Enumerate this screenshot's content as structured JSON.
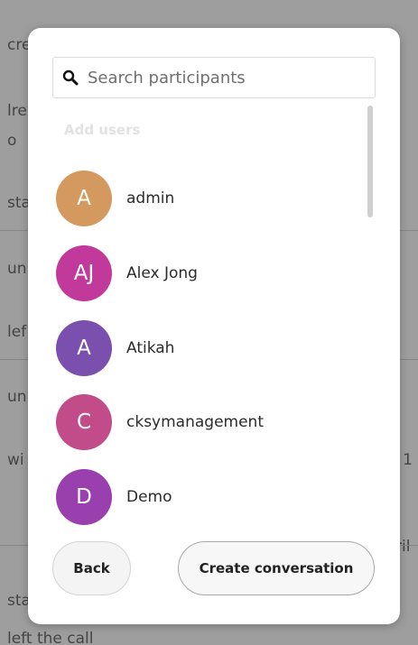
{
  "background": {
    "fragments": [
      "cre",
      "lre",
      "o",
      "sta",
      "un",
      "lef",
      "un",
      "wi",
      "n 1",
      "ril",
      "sta",
      "left the call"
    ]
  },
  "modal": {
    "search": {
      "placeholder": "Search participants",
      "value": ""
    },
    "section_label": "Add users",
    "users": [
      {
        "initials": "A",
        "name": "admin",
        "color": "#d4995f"
      },
      {
        "initials": "AJ",
        "name": "Alex Jong",
        "color": "#c1399a"
      },
      {
        "initials": "A",
        "name": "Atikah",
        "color": "#7b4fae"
      },
      {
        "initials": "C",
        "name": "cksymanagement",
        "color": "#c24b8a"
      },
      {
        "initials": "D",
        "name": "Demo",
        "color": "#9a3fae"
      }
    ],
    "buttons": {
      "back": "Back",
      "create": "Create conversation"
    }
  },
  "icons": {
    "search": "search-icon"
  }
}
